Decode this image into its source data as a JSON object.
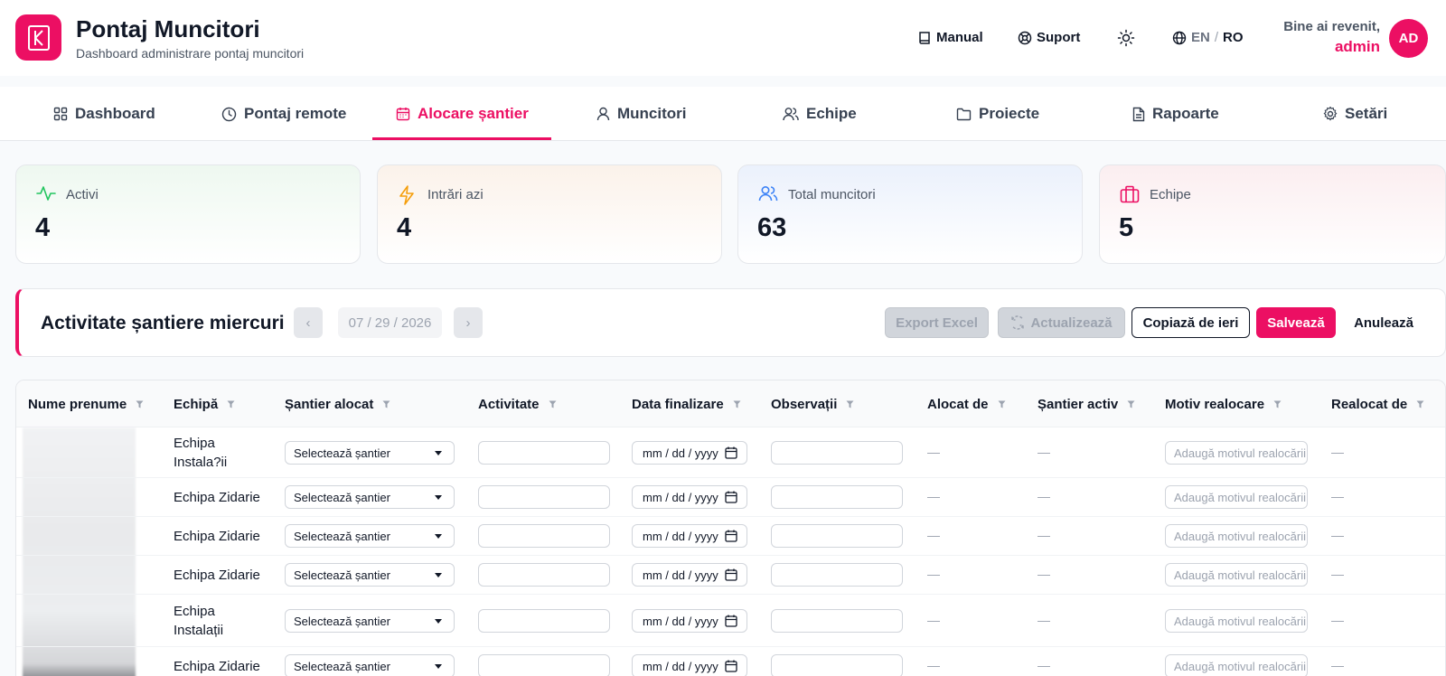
{
  "app": {
    "title": "Pontaj Muncitori",
    "subtitle": "Dashboard administrare pontaj muncitori"
  },
  "header": {
    "manual_label": "Manual",
    "support_label": "Suport",
    "lang_en": "EN",
    "lang_sep": "/",
    "lang_ro": "RO",
    "welcome_text": "Bine ai revenit,",
    "username": "admin",
    "avatar_initials": "AD"
  },
  "nav": {
    "tabs": [
      {
        "label": "Dashboard",
        "icon": "grid-icon"
      },
      {
        "label": "Pontaj remote",
        "icon": "clock-icon"
      },
      {
        "label": "Alocare șantier",
        "icon": "calendar-icon",
        "active": true
      },
      {
        "label": "Muncitori",
        "icon": "user-icon"
      },
      {
        "label": "Echipe",
        "icon": "users-icon"
      },
      {
        "label": "Proiecte",
        "icon": "folder-icon"
      },
      {
        "label": "Rapoarte",
        "icon": "file-icon"
      },
      {
        "label": "Setări",
        "icon": "gear-icon"
      }
    ]
  },
  "stats": [
    {
      "label": "Activi",
      "value": "4",
      "icon": "activity-icon",
      "color": "#22c55e"
    },
    {
      "label": "Intrări azi",
      "value": "4",
      "icon": "bolt-icon",
      "color": "#f59e0b"
    },
    {
      "label": "Total muncitori",
      "value": "63",
      "icon": "users-icon",
      "color": "#3b82f6"
    },
    {
      "label": "Echipe",
      "value": "5",
      "icon": "briefcase-icon",
      "color": "#ec0f63"
    }
  ],
  "activity": {
    "title": "Activitate șantiere miercuri",
    "prev_label": "‹",
    "next_label": "›",
    "date_value": "07 / 29 / 2026",
    "export_label": "Export Excel",
    "refresh_label": "Actualizează",
    "copy_label": "Copiază de ieri",
    "save_label": "Salvează",
    "cancel_label": "Anulează"
  },
  "table": {
    "columns": [
      "Nume prenume",
      "Echipă",
      "Șantier alocat",
      "Activitate",
      "Data finalizare",
      "Observații",
      "Alocat de",
      "Șantier activ",
      "Motiv realocare",
      "Realocat de"
    ],
    "select_placeholder": "Selectează șantier",
    "date_placeholder": "mm / dd / yyyy",
    "motiv_placeholder": "Adaugă motivul realocării",
    "empty_value": "—",
    "rows": [
      {
        "team": "Echipa Instala?ii"
      },
      {
        "team": "Echipa Zidarie"
      },
      {
        "team": "Echipa Zidarie"
      },
      {
        "team": "Echipa Zidarie"
      },
      {
        "team": "Echipa Instalații"
      },
      {
        "team": "Echipa Zidarie"
      }
    ]
  },
  "colors": {
    "brand": "#ec0f63",
    "text": "#111827",
    "muted": "#6b7280"
  }
}
